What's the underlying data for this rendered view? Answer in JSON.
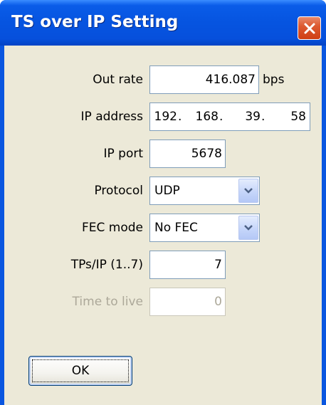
{
  "window": {
    "title": "TS over IP Setting",
    "close_icon": "close-icon",
    "title_color": "#ffffff",
    "titlebar_color": "#0654e0",
    "client_bg": "#ece9d8"
  },
  "form": {
    "out_rate": {
      "label": "Out rate",
      "value": "416.087",
      "unit": "bps"
    },
    "ip_address": {
      "label": "IP address",
      "octets": [
        "192",
        "168",
        "39",
        "58"
      ],
      "separator": "."
    },
    "ip_port": {
      "label": "IP port",
      "value": "5678"
    },
    "protocol": {
      "label": "Protocol",
      "value": "UDP",
      "icon": "chevron-down-icon"
    },
    "fec_mode": {
      "label": "FEC mode",
      "value": "No FEC",
      "icon": "chevron-down-icon"
    },
    "tps_per_ip": {
      "label": "TPs/IP (1..7)",
      "value": "7"
    },
    "time_to_live": {
      "label": "Time to live",
      "value": "0",
      "enabled": false
    }
  },
  "buttons": {
    "ok_label": "OK"
  }
}
